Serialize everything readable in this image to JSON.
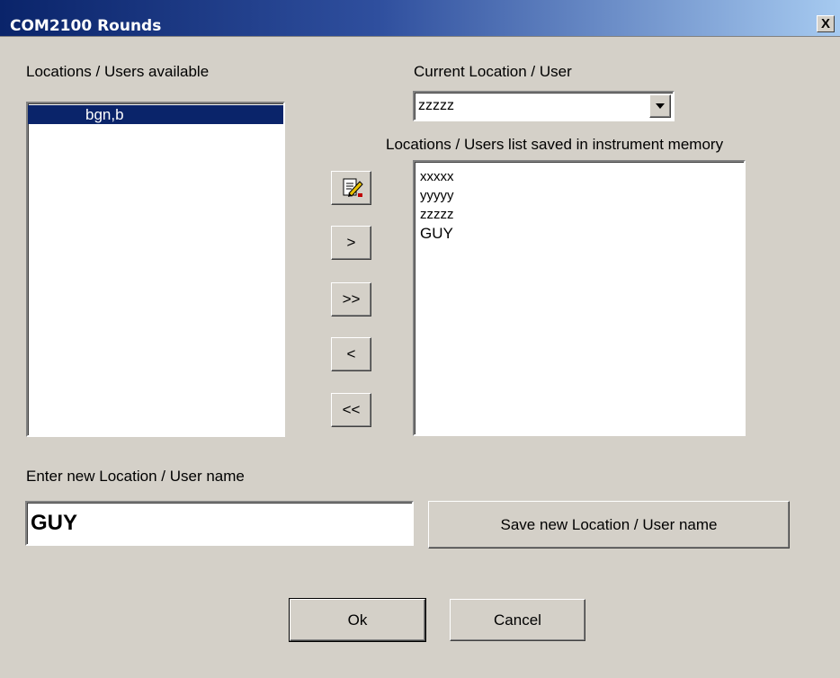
{
  "window": {
    "title": "COM2100 Rounds",
    "close_glyph": "X"
  },
  "available": {
    "label": "Locations / Users available",
    "items": [
      {
        "text": "bgn,b",
        "selected": true
      }
    ]
  },
  "current": {
    "label": "Current Location / User",
    "value": "zzzzz"
  },
  "saved": {
    "label": "Locations / Users list saved in instrument memory",
    "items": [
      "xxxxx",
      "yyyyy",
      "zzzzz",
      "GUY"
    ]
  },
  "transfer_buttons": {
    "icon": "edit-pencil-icon",
    "move_one_right": ">",
    "move_all_right": ">>",
    "move_one_left": "<",
    "move_all_left": "<<"
  },
  "new_entry": {
    "label": "Enter new Location / User name",
    "value": "GUY",
    "save_label": "Save new Location / User name"
  },
  "footer": {
    "ok_label": "Ok",
    "cancel_label": "Cancel"
  }
}
